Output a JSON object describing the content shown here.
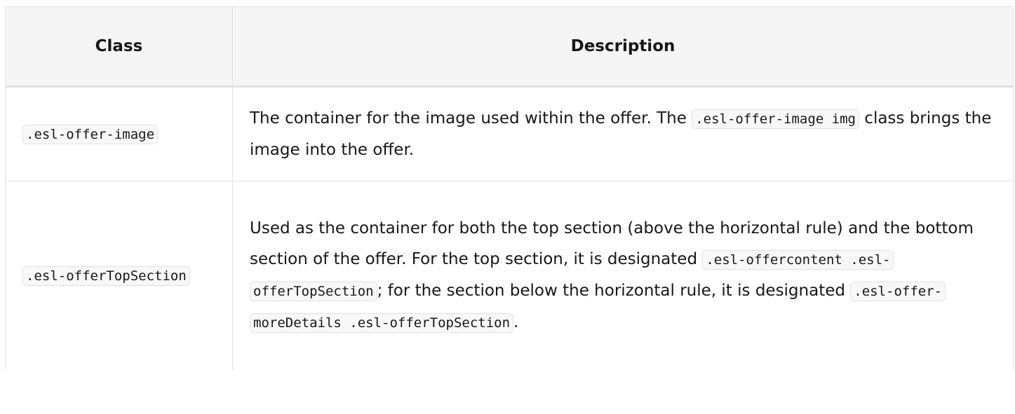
{
  "table": {
    "headers": {
      "class": "Class",
      "description": "Description"
    },
    "rows": [
      {
        "class_code": ".esl-offer-image",
        "description": {
          "text_before": "The container for the image used within the offer. The ",
          "code": ".esl-offer-image img",
          "text_after": " class brings the image into the offer."
        }
      },
      {
        "class_code": ".esl-offerTopSection",
        "description": {
          "text_1": "Used as the container for both the top section (above the horizontal rule) and the bottom section of the offer. For the top section, it is designated ",
          "code_1": ".esl-offercontent .esl-offerTopSection",
          "text_2": "; for the section below the horizontal rule, it is designated ",
          "code_2": ".esl-offer-moreDetails .esl-offerTopSection",
          "text_3": "."
        }
      }
    ]
  }
}
